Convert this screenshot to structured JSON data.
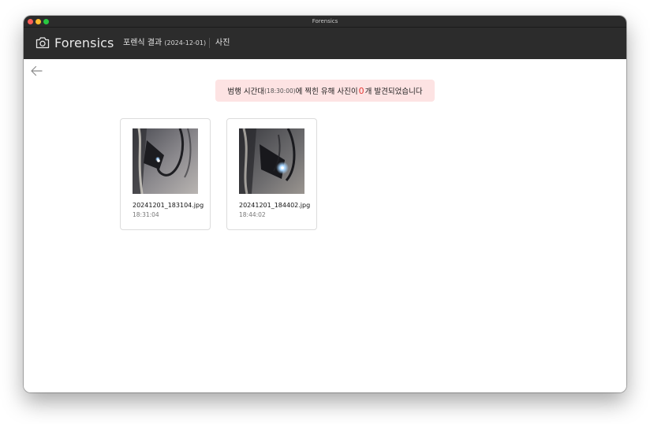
{
  "window": {
    "title": "Forensics"
  },
  "appbar": {
    "brand": "Forensics",
    "crumb_result": "포렌식 결과",
    "crumb_date": "(2024-12-01)",
    "crumb_section": "사진"
  },
  "alert": {
    "prefix": "범행 시간대",
    "time": "(18:30:00)",
    "middle": "에 찍힌 유해 사진이 ",
    "count": "0",
    "suffix": "개 발견되었습니다"
  },
  "photos": [
    {
      "filename": "20241201_183104.jpg",
      "time": "18:31:04"
    },
    {
      "filename": "20241201_184402.jpg",
      "time": "18:44:02"
    }
  ],
  "colors": {
    "appbar_bg": "#2c2c2c",
    "alert_bg": "#fde3e3",
    "alert_count": "#e53935"
  }
}
